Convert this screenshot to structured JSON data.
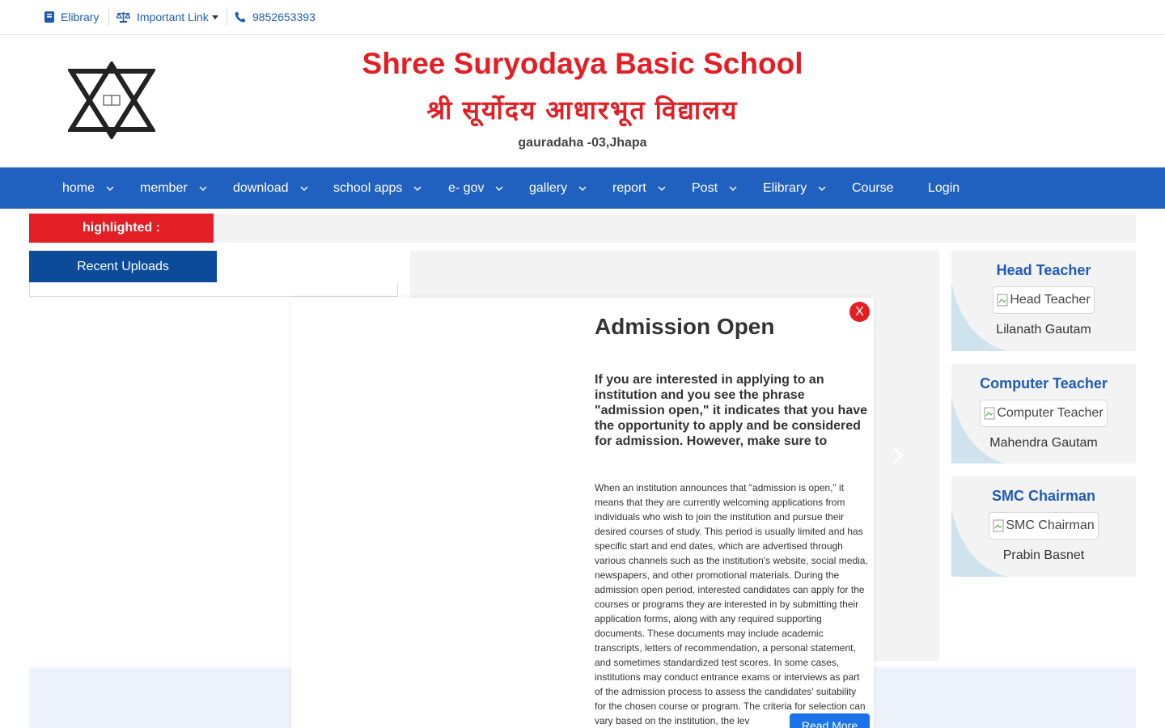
{
  "topbar": {
    "elibrary_label": "Elibrary",
    "important_link_label": "Important Link",
    "phone": "9852653393"
  },
  "header": {
    "school_name": "Shree Suryodaya Basic School",
    "school_name_nepali": "श्री सूर्योदय आधारभूत विद्यालय",
    "address": "gauradaha -03,Jhapa"
  },
  "nav": {
    "items": [
      {
        "label": "home",
        "has_dropdown": true
      },
      {
        "label": "member",
        "has_dropdown": true
      },
      {
        "label": "download",
        "has_dropdown": true
      },
      {
        "label": "school apps",
        "has_dropdown": true
      },
      {
        "label": "e- gov",
        "has_dropdown": true
      },
      {
        "label": "gallery",
        "has_dropdown": true
      },
      {
        "label": "report",
        "has_dropdown": true
      },
      {
        "label": "Post",
        "has_dropdown": true
      },
      {
        "label": "Elibrary",
        "has_dropdown": true
      },
      {
        "label": "Course",
        "has_dropdown": false
      },
      {
        "label": "Login",
        "has_dropdown": false
      }
    ]
  },
  "ticker": {
    "label": "highlighted :"
  },
  "recent": {
    "tab_label": "Recent Uploads"
  },
  "staff": [
    {
      "role": "Head Teacher",
      "photo_alt": "Head Teacher",
      "name": "Lilanath Gautam"
    },
    {
      "role": "Computer Teacher",
      "photo_alt": "Computer Teacher",
      "name": "Mahendra Gautam"
    },
    {
      "role": "SMC Chairman",
      "photo_alt": "SMC Chairman",
      "name": "Prabin Basnet"
    }
  ],
  "modal": {
    "close_label": "X",
    "title": "Admission Open",
    "lead": "If you are interested in applying to an institution and you see the phrase \"admission open,\" it indicates that you have the opportunity to apply and be considered for admission. However, make sure to",
    "body": "When an institution announces that \"admission is open,\" it means that they are currently welcoming applications from individuals who wish to join the institution and pursue their desired courses of study. This period is usually limited and has specific start and end dates, which are advertised through various channels such as the institution's website, social media, newspapers, and other promotional materials. During the admission open period, interested candidates can apply for the courses or programs they are interested in by submitting their application forms, along with any required supporting documents. These documents may include academic transcripts, letters of recommendation, a personal statement, and sometimes standardized test scores. In some cases, institutions may conduct entrance exams or interviews as part of the admission process to assess the candidates' suitability for the chosen course or program. The criteria for selection can vary based on the institution, the lev",
    "read_more_label": "Read More"
  },
  "colors": {
    "brand_red": "#e31e24",
    "nav_blue": "#2061c0",
    "dark_blue": "#0b4b99",
    "link_blue": "#1e5bb8",
    "button_blue": "#1a73e8"
  },
  "icons": {
    "elibrary": "book-icon",
    "important_link": "balance-scale-icon",
    "phone": "phone-icon",
    "logo": "star-of-david-book-logo",
    "slider_next": "chevron-right-icon"
  }
}
